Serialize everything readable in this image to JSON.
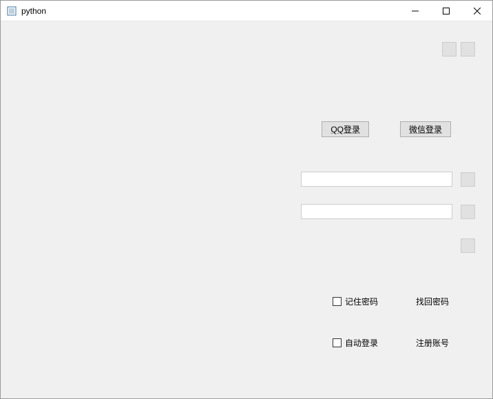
{
  "window": {
    "title": "python"
  },
  "login_buttons": {
    "qq": "QQ登录",
    "wechat": "微信登录"
  },
  "inputs": {
    "field1": "",
    "field2": ""
  },
  "options": {
    "remember_password_label": "记住密码",
    "find_password_label": "找回密码",
    "auto_login_label": "自动登录",
    "register_label": "注册账号"
  }
}
